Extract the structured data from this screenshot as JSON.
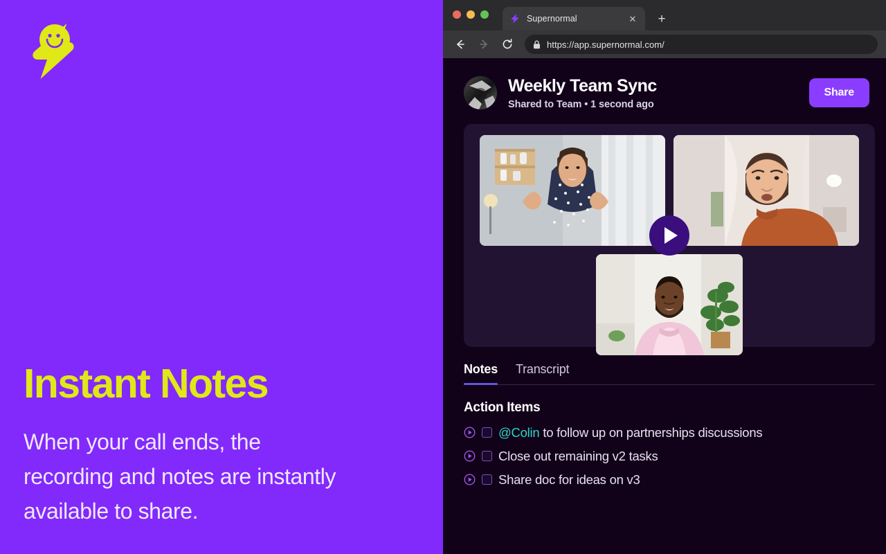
{
  "brand": {
    "logo_icon": "bolt-smiley-logo",
    "accent_yellow": "#E0E817",
    "panel_purple": "#8229FC"
  },
  "marketing": {
    "headline": "Instant Notes",
    "subhead": "When your call ends, the recording and notes are instantly available to share."
  },
  "browser": {
    "traffic_lights": [
      "close-red",
      "minimize-yellow",
      "maximize-green"
    ],
    "tab": {
      "title": "Supernormal",
      "favicon_icon": "supernormal-bolt-favicon",
      "close_label": "✕"
    },
    "new_tab_label": "+",
    "nav": {
      "back_icon": "arrow-left-icon",
      "forward_icon": "arrow-right-icon",
      "reload_icon": "reload-icon"
    },
    "omnibox": {
      "lock_icon": "lock-icon",
      "url": "https://app.supernormal.com/"
    }
  },
  "app": {
    "header": {
      "avatar_icon": "user-avatar",
      "title": "Weekly Team Sync",
      "subtitle": "Shared to Team • 1 second ago",
      "share_label": "Share",
      "share_color": "#8B3DFF"
    },
    "video": {
      "play_icon": "play-button",
      "participants": [
        {
          "name": "participant-woman-gesturing",
          "position": "top-left"
        },
        {
          "name": "participant-man-orange-shirt",
          "position": "top-right"
        },
        {
          "name": "participant-man-pink-shirt",
          "position": "bottom-center"
        }
      ]
    },
    "tabs": [
      {
        "label": "Notes",
        "active": true
      },
      {
        "label": "Transcript",
        "active": false
      }
    ],
    "notes": {
      "section_title": "Action Items",
      "items": [
        {
          "mention": "@Colin",
          "text": " to follow up on partnerships discussions",
          "checked": false
        },
        {
          "mention": "",
          "text": "Close out remaining v2 tasks",
          "checked": false
        },
        {
          "mention": "",
          "text": "Share doc for ideas on v3",
          "checked": false
        }
      ],
      "mention_color": "#2ED3C6",
      "item_play_icon": "play-circle-icon",
      "item_checkbox_icon": "checkbox-unchecked-icon"
    }
  }
}
